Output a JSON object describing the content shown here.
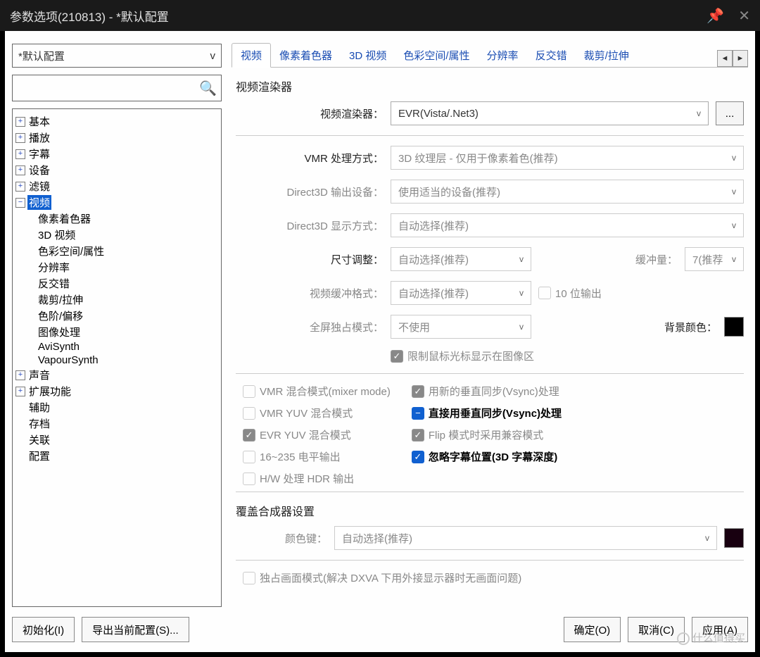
{
  "window": {
    "title": "参数选项(210813) - *默认配置"
  },
  "profile": {
    "selected": "*默认配置"
  },
  "tabs": {
    "items": [
      "视频",
      "像素着色器",
      "3D 视频",
      "色彩空间/属性",
      "分辨率",
      "反交错",
      "裁剪/拉伸"
    ],
    "active": 0
  },
  "tree": {
    "basic": "基本",
    "playback": "播放",
    "subtitle": "字幕",
    "device": "设备",
    "filter": "滤镜",
    "video": "视频",
    "video_children": [
      "像素着色器",
      "3D 视频",
      "色彩空间/属性",
      "分辨率",
      "反交错",
      "裁剪/拉伸",
      "色阶/偏移",
      "图像处理",
      "AviSynth",
      "VapourSynth"
    ],
    "audio": "声音",
    "extend": "扩展功能",
    "assist": "辅助",
    "archive": "存档",
    "assoc": "关联",
    "config": "配置"
  },
  "video": {
    "group_renderer": "视频渲染器",
    "renderer_label": "视频渲染器：",
    "renderer_value": "EVR(Vista/.Net3)",
    "renderer_more": "...",
    "vmr_label": "VMR 处理方式：",
    "vmr_value": "3D 纹理层 - 仅用于像素着色(推荐)",
    "d3d_out_label": "Direct3D 输出设备：",
    "d3d_out_value": "使用适当的设备(推荐)",
    "d3d_disp_label": "Direct3D 显示方式：",
    "d3d_disp_value": "自动选择(推荐)",
    "resize_label": "尺寸调整：",
    "resize_value": "自动选择(推荐)",
    "buffer_label": "缓冲量：",
    "buffer_value": "7(推荐",
    "bufferfmt_label": "视频缓冲格式：",
    "bufferfmt_value": "自动选择(推荐)",
    "tenbit": "10 位输出",
    "fullscreen_label": "全屏独占模式：",
    "fullscreen_value": "不使用",
    "bgcolor_label": "背景颜色：",
    "restrict_cursor": "限制鼠标光标显示在图像区",
    "cb_vmr_mix": "VMR 混合模式(mixer mode)",
    "cb_vmr_yuv": "VMR YUV 混合模式",
    "cb_evr_yuv": "EVR YUV 混合模式",
    "cb_16_235": "16~235 电平输出",
    "cb_hw_hdr": "H/W 处理 HDR 输出",
    "cb_new_vsync": "用新的垂直同步(Vsync)处理",
    "cb_direct_vsync": "直接用垂直同步(Vsync)处理",
    "cb_flip_compat": "Flip 模式时采用兼容模式",
    "cb_ignore_sub": "忽略字幕位置(3D 字幕深度)",
    "group_overlay": "覆盖合成器设置",
    "colorkey_label": "颜色键：",
    "colorkey_value": "自动选择(推荐)",
    "exclusive": "独占画面模式(解决 DXVA 下用外接显示器时无画面问题)"
  },
  "buttons": {
    "init": "初始化(I)",
    "export": "导出当前配置(S)...",
    "ok": "确定(O)",
    "cancel": "取消(C)",
    "apply": "应用(A)"
  },
  "watermark": "什么值得买"
}
